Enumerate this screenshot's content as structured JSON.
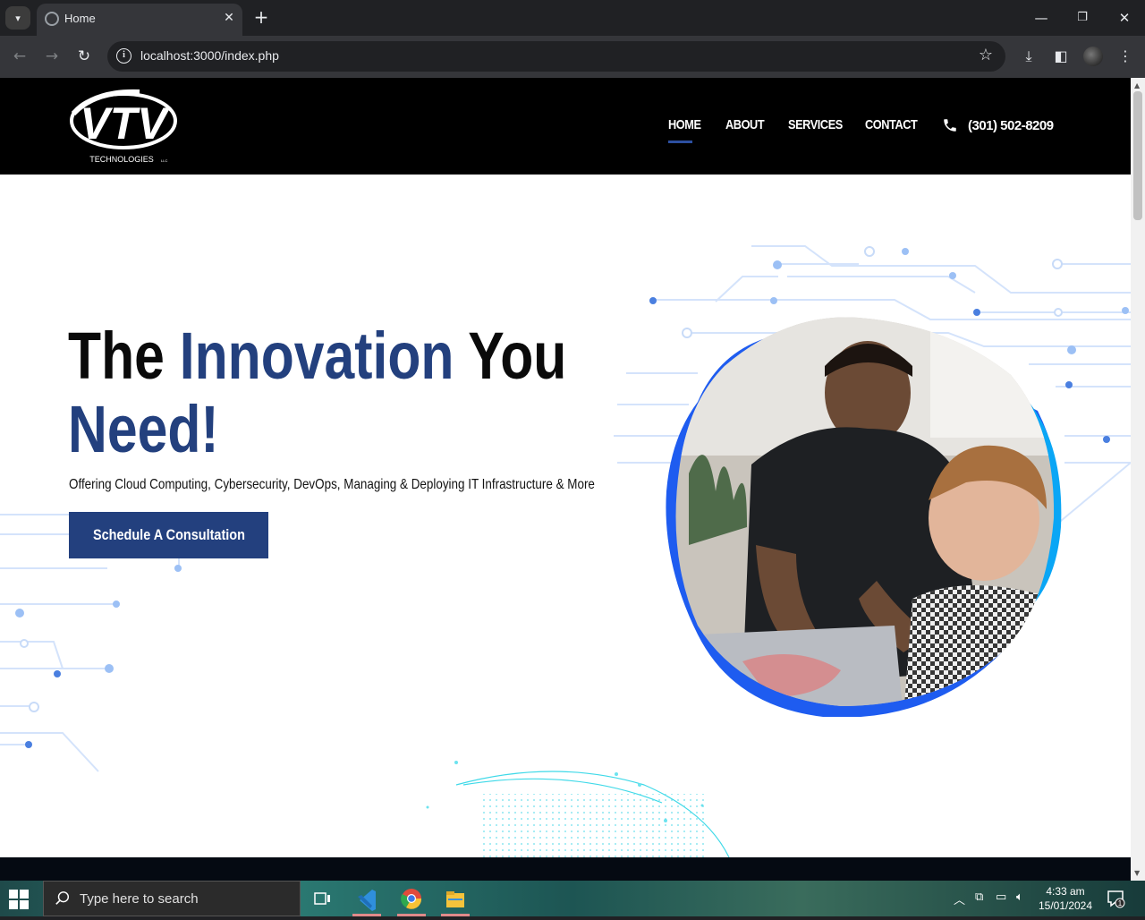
{
  "browser": {
    "tab_title": "Home",
    "url": "localhost:3000/index.php"
  },
  "site": {
    "logo_text": "VTV",
    "logo_subtext": "TECHNOLOGIES",
    "logo_suffix": "LLC",
    "nav": [
      {
        "label": "HOME",
        "active": true
      },
      {
        "label": "ABOUT",
        "active": false
      },
      {
        "label": "SERVICES",
        "active": false
      },
      {
        "label": "CONTACT",
        "active": false
      }
    ],
    "phone": "(301) 502-8209",
    "accent_color": "#23407e"
  },
  "hero": {
    "title_word1": "The",
    "title_word2": "Innovation",
    "title_word3": "You",
    "title_word4": "Need!",
    "subtitle": "Offering Cloud Computing, Cybersecurity, DevOps, Managing & Deploying IT Infrastructure & More",
    "cta_label": "Schedule A Consultation"
  },
  "taskbar": {
    "search_placeholder": "Type here to search",
    "time": "4:33 am",
    "date": "15/01/2024",
    "notification_count": "1"
  }
}
